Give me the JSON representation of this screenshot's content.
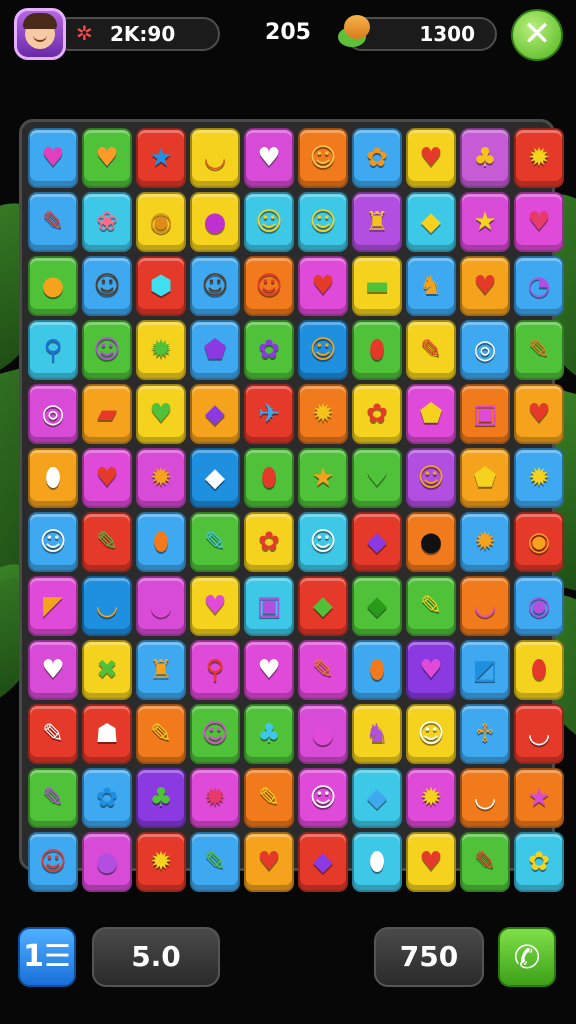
{
  "header": {
    "timer": "2K:90",
    "timer_icon": "gear-icon",
    "score": "205",
    "coins": "1300",
    "coin_icon": "coin-stack-icon",
    "close_icon": "close-icon",
    "close_glyph": "✕"
  },
  "board": {
    "rows": [
      [
        {
          "color": "#3ea8f0",
          "glyph": "♥",
          "fg": "#e23fbf"
        },
        {
          "color": "#4fc23a",
          "glyph": "♥",
          "fg": "#ff9a2a"
        },
        {
          "color": "#e53a2a",
          "glyph": "★",
          "fg": "#1f8fe0"
        },
        {
          "color": "#f5d21d",
          "glyph": "◡",
          "fg": "#e0581c"
        },
        {
          "color": "#d84bd6",
          "glyph": "♥",
          "fg": "#ffffff"
        },
        {
          "color": "#f07a1c",
          "glyph": "☺",
          "fg": "#f8c44a"
        },
        {
          "color": "#3ea8f0",
          "glyph": "✿",
          "fg": "#f0961c"
        },
        {
          "color": "#f5d21d",
          "glyph": "♥",
          "fg": "#e53a2a"
        },
        {
          "color": "#c65bd6",
          "glyph": "♣",
          "fg": "#f5c21d"
        },
        {
          "color": "#e53a2a",
          "glyph": "✹",
          "fg": "#f5d21d"
        }
      ],
      [
        {
          "color": "#3ea8f0",
          "glyph": "✎",
          "fg": "#e53a2a"
        },
        {
          "color": "#3ec8e8",
          "glyph": "❀",
          "fg": "#ff6a8a"
        },
        {
          "color": "#f5d21d",
          "glyph": "◉",
          "fg": "#e08a1c"
        },
        {
          "color": "#f5d21d",
          "glyph": "●",
          "fg": "#c02fd0"
        },
        {
          "color": "#3ec8e8",
          "glyph": "☺",
          "fg": "#f5d21d"
        },
        {
          "color": "#3ec8e8",
          "glyph": "☺",
          "fg": "#f5d21d"
        },
        {
          "color": "#b24fe0",
          "glyph": "♜",
          "fg": "#f5c21d"
        },
        {
          "color": "#3ec8e8",
          "glyph": "◆",
          "fg": "#f5d21d"
        },
        {
          "color": "#d84bd6",
          "glyph": "★",
          "fg": "#f5d21d"
        },
        {
          "color": "#e04ad8",
          "glyph": "♥",
          "fg": "#e53a6a"
        }
      ],
      [
        {
          "color": "#4fc23a",
          "glyph": "●",
          "fg": "#f5a21d"
        },
        {
          "color": "#3ea8f0",
          "glyph": "☺",
          "fg": "#5a3a20"
        },
        {
          "color": "#e53a2a",
          "glyph": "⬢",
          "fg": "#3ee0f0"
        },
        {
          "color": "#3ea8f0",
          "glyph": "☺",
          "fg": "#5a3a20"
        },
        {
          "color": "#f07a1c",
          "glyph": "☺",
          "fg": "#e53a2a"
        },
        {
          "color": "#e04ad8",
          "glyph": "♥",
          "fg": "#e53a2a"
        },
        {
          "color": "#f5d21d",
          "glyph": "▬",
          "fg": "#4fc23a"
        },
        {
          "color": "#3ea8f0",
          "glyph": "♞",
          "fg": "#f5a21d"
        },
        {
          "color": "#f5a21d",
          "glyph": "♥",
          "fg": "#e53a2a"
        },
        {
          "color": "#3ea8f0",
          "glyph": "◔",
          "fg": "#b24fe0"
        }
      ],
      [
        {
          "color": "#3ec8e8",
          "glyph": "⚲",
          "fg": "#1a6fd8"
        },
        {
          "color": "#4fc23a",
          "glyph": "☺",
          "fg": "#b24fe0"
        },
        {
          "color": "#f5d21d",
          "glyph": "✹",
          "fg": "#4fc23a"
        },
        {
          "color": "#3ea8f0",
          "glyph": "⬟",
          "fg": "#8a3ae0"
        },
        {
          "color": "#4fc23a",
          "glyph": "✿",
          "fg": "#8a3ae0"
        },
        {
          "color": "#1f8fe0",
          "glyph": "☺",
          "fg": "#f5a21d"
        },
        {
          "color": "#4fc23a",
          "glyph": "⬮",
          "fg": "#e53a2a"
        },
        {
          "color": "#f5d21d",
          "glyph": "✎",
          "fg": "#e53a2a"
        },
        {
          "color": "#3ea8f0",
          "glyph": "◎",
          "fg": "#ffffff"
        },
        {
          "color": "#4fc23a",
          "glyph": "✎",
          "fg": "#f07a1c"
        }
      ],
      [
        {
          "color": "#d84bd6",
          "glyph": "◎",
          "fg": "#ffffff"
        },
        {
          "color": "#f5a21d",
          "glyph": "▰",
          "fg": "#e53a2a"
        },
        {
          "color": "#f5d21d",
          "glyph": "♥",
          "fg": "#4fc23a"
        },
        {
          "color": "#f5a21d",
          "glyph": "◆",
          "fg": "#8a3ae0"
        },
        {
          "color": "#e53a2a",
          "glyph": "✈",
          "fg": "#3ea8f0"
        },
        {
          "color": "#f07a1c",
          "glyph": "✹",
          "fg": "#f5c21d"
        },
        {
          "color": "#f5d21d",
          "glyph": "✿",
          "fg": "#e53a2a"
        },
        {
          "color": "#e04ad8",
          "glyph": "⬟",
          "fg": "#f5d21d"
        },
        {
          "color": "#f07a1c",
          "glyph": "▣",
          "fg": "#e04ad8"
        },
        {
          "color": "#f5a21d",
          "glyph": "♥",
          "fg": "#e53a2a"
        }
      ],
      [
        {
          "color": "#f5a21d",
          "glyph": "⬮",
          "fg": "#ffffff"
        },
        {
          "color": "#e04ad8",
          "glyph": "♥",
          "fg": "#e53a2a"
        },
        {
          "color": "#d84bd6",
          "glyph": "✹",
          "fg": "#f5a21d"
        },
        {
          "color": "#1f8fe0",
          "glyph": "◆",
          "fg": "#ffffff"
        },
        {
          "color": "#4fc23a",
          "glyph": "⬮",
          "fg": "#e53a2a"
        },
        {
          "color": "#4fc23a",
          "glyph": "★",
          "fg": "#f5a21d"
        },
        {
          "color": "#4fc23a",
          "glyph": "♥",
          "fg": "#4fc23a"
        },
        {
          "color": "#b24fe0",
          "glyph": "☺",
          "fg": "#f5a21d"
        },
        {
          "color": "#f5a21d",
          "glyph": "⬟",
          "fg": "#f5d21d"
        },
        {
          "color": "#3ea8f0",
          "glyph": "✹",
          "fg": "#f5d21d"
        }
      ],
      [
        {
          "color": "#3ea8f0",
          "glyph": "☺",
          "fg": "#ffffff"
        },
        {
          "color": "#e53a2a",
          "glyph": "✎",
          "fg": "#4fc23a"
        },
        {
          "color": "#3ea8f0",
          "glyph": "⬮",
          "fg": "#f07a1c"
        },
        {
          "color": "#4fc23a",
          "glyph": "✎",
          "fg": "#3ec8e8"
        },
        {
          "color": "#f5d21d",
          "glyph": "✿",
          "fg": "#e53a2a"
        },
        {
          "color": "#3ec8e8",
          "glyph": "☺",
          "fg": "#ffffff"
        },
        {
          "color": "#e53a2a",
          "glyph": "◆",
          "fg": "#8a3ae0"
        },
        {
          "color": "#f07a1c",
          "glyph": "●",
          "fg": "#111111"
        },
        {
          "color": "#3ea8f0",
          "glyph": "✹",
          "fg": "#f5a21d"
        },
        {
          "color": "#e53a2a",
          "glyph": "◉",
          "fg": "#f5a21d"
        }
      ],
      [
        {
          "color": "#e04ad8",
          "glyph": "◤",
          "fg": "#f5a21d"
        },
        {
          "color": "#1f8fe0",
          "glyph": "◡",
          "fg": "#f5a21d"
        },
        {
          "color": "#d84bd6",
          "glyph": "◡",
          "fg": "#e04ad8"
        },
        {
          "color": "#f5d21d",
          "glyph": "♥",
          "fg": "#e04ad8"
        },
        {
          "color": "#3ec8e8",
          "glyph": "▣",
          "fg": "#b24fe0"
        },
        {
          "color": "#e53a2a",
          "glyph": "◆",
          "fg": "#4fc23a"
        },
        {
          "color": "#4fc23a",
          "glyph": "◆",
          "fg": "#2a9a1a"
        },
        {
          "color": "#4fc23a",
          "glyph": "✎",
          "fg": "#f5d21d"
        },
        {
          "color": "#f07a1c",
          "glyph": "◡",
          "fg": "#e04ad8"
        },
        {
          "color": "#3ea8f0",
          "glyph": "◉",
          "fg": "#b24fe0"
        }
      ],
      [
        {
          "color": "#d84bd6",
          "glyph": "♥",
          "fg": "#ffffff"
        },
        {
          "color": "#f5d21d",
          "glyph": "✖",
          "fg": "#4fc23a"
        },
        {
          "color": "#3ea8f0",
          "glyph": "♜",
          "fg": "#f5a21d"
        },
        {
          "color": "#e04ad8",
          "glyph": "⚲",
          "fg": "#e53a2a"
        },
        {
          "color": "#e04ad8",
          "glyph": "♥",
          "fg": "#ffffff"
        },
        {
          "color": "#e04ad8",
          "glyph": "✎",
          "fg": "#f07a1c"
        },
        {
          "color": "#3ea8f0",
          "glyph": "⬮",
          "fg": "#f07a1c"
        },
        {
          "color": "#8a3ae0",
          "glyph": "♥",
          "fg": "#e04ad8"
        },
        {
          "color": "#3ea8f0",
          "glyph": "◩",
          "fg": "#1f8fe0"
        },
        {
          "color": "#f5d21d",
          "glyph": "⬮",
          "fg": "#e53a2a"
        }
      ],
      [
        {
          "color": "#e53a2a",
          "glyph": "✎",
          "fg": "#ffffff"
        },
        {
          "color": "#e53a2a",
          "glyph": "☗",
          "fg": "#ffffff"
        },
        {
          "color": "#f07a1c",
          "glyph": "✎",
          "fg": "#f5d21d"
        },
        {
          "color": "#4fc23a",
          "glyph": "☺",
          "fg": "#e04ad8"
        },
        {
          "color": "#4fc23a",
          "glyph": "♣",
          "fg": "#3ec8e8"
        },
        {
          "color": "#d84bd6",
          "glyph": "●",
          "fg": "#e04ad8"
        },
        {
          "color": "#f5d21d",
          "glyph": "♞",
          "fg": "#b24fe0"
        },
        {
          "color": "#f5d21d",
          "glyph": "☺",
          "fg": "#ffffff"
        },
        {
          "color": "#3ea8f0",
          "glyph": "♱",
          "fg": "#f5a21d"
        },
        {
          "color": "#e53a2a",
          "glyph": "◡",
          "fg": "#ffffff"
        }
      ],
      [
        {
          "color": "#4fc23a",
          "glyph": "✎",
          "fg": "#b24fe0"
        },
        {
          "color": "#3ea8f0",
          "glyph": "✿",
          "fg": "#1f8fe0"
        },
        {
          "color": "#8a3ae0",
          "glyph": "♣",
          "fg": "#4fc23a"
        },
        {
          "color": "#e04ad8",
          "glyph": "✹",
          "fg": "#e53a6a"
        },
        {
          "color": "#f07a1c",
          "glyph": "✎",
          "fg": "#f5d21d"
        },
        {
          "color": "#e04ad8",
          "glyph": "☺",
          "fg": "#ffffff"
        },
        {
          "color": "#3ec8e8",
          "glyph": "◆",
          "fg": "#3ea8f0"
        },
        {
          "color": "#e04ad8",
          "glyph": "✹",
          "fg": "#f5d21d"
        },
        {
          "color": "#f07a1c",
          "glyph": "◡",
          "fg": "#ffffff"
        },
        {
          "color": "#f07a1c",
          "glyph": "★",
          "fg": "#d84bd6"
        }
      ],
      [
        {
          "color": "#3ea8f0",
          "glyph": "☺",
          "fg": "#e53a2a"
        },
        {
          "color": "#d84bd6",
          "glyph": "●",
          "fg": "#b24fe0"
        },
        {
          "color": "#e53a2a",
          "glyph": "✹",
          "fg": "#f5d21d"
        },
        {
          "color": "#3ea8f0",
          "glyph": "✎",
          "fg": "#4fc23a"
        },
        {
          "color": "#f5a21d",
          "glyph": "♥",
          "fg": "#e53a2a"
        },
        {
          "color": "#e53a2a",
          "glyph": "◆",
          "fg": "#8a3ae0"
        },
        {
          "color": "#3ec8e8",
          "glyph": "⬮",
          "fg": "#ffffff"
        },
        {
          "color": "#f5d21d",
          "glyph": "♥",
          "fg": "#e53a2a"
        },
        {
          "color": "#4fc23a",
          "glyph": "✎",
          "fg": "#e53a2a"
        },
        {
          "color": "#3ec8e8",
          "glyph": "✿",
          "fg": "#f5d21d"
        }
      ]
    ]
  },
  "footer": {
    "menu_icon": "menu-icon",
    "menu_glyph": "1☰",
    "level": "5.0",
    "points": "750",
    "call_icon": "phone-icon",
    "call_glyph": "✆"
  }
}
